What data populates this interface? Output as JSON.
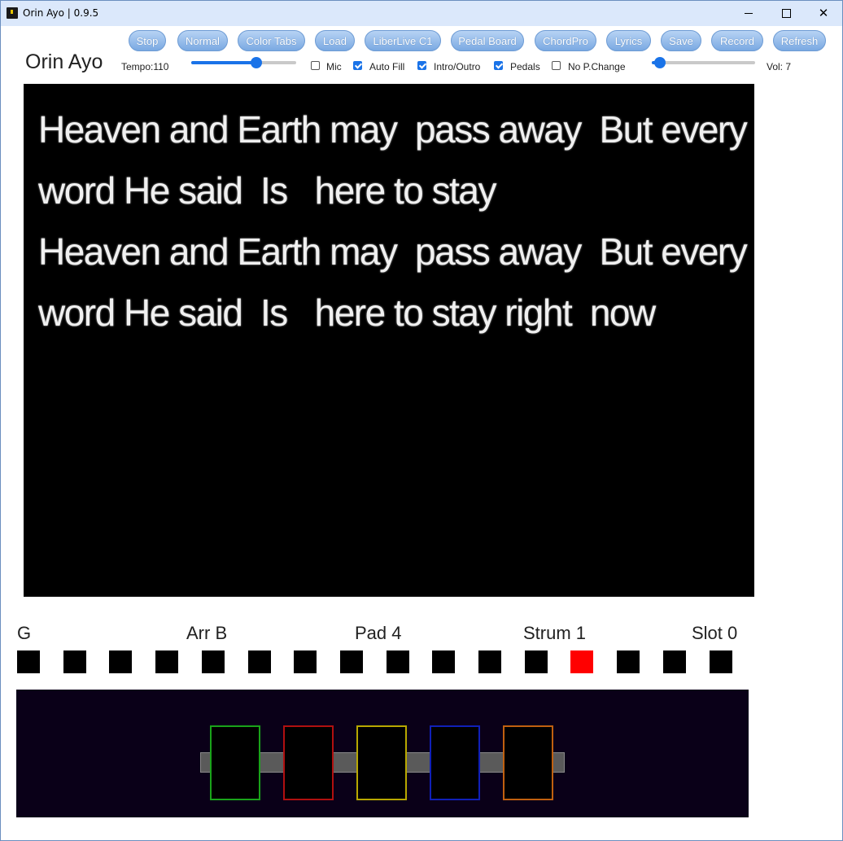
{
  "window": {
    "title": "Orin Ayo | 0.9.5",
    "controls": {
      "minimize": "minimize-icon",
      "maximize": "maximize-icon",
      "close": "close-icon"
    }
  },
  "toolbar": {
    "buttons": [
      "Stop",
      "Normal",
      "Color Tabs",
      "Load",
      "LiberLive C1",
      "Pedal Board",
      "ChordPro",
      "Lyrics",
      "Save",
      "Record",
      "Refresh"
    ]
  },
  "header": {
    "brand": "Orin Ayo",
    "tempo_label": "Tempo:110",
    "tempo_level": 0.62,
    "volume_label": "Vol: 7",
    "volume_level": 0.08,
    "options": [
      {
        "label": "Mic",
        "checked": false
      },
      {
        "label": "Auto Fill",
        "checked": true
      },
      {
        "label": "Intro/Outro",
        "checked": true
      },
      {
        "label": "Pedals",
        "checked": true
      },
      {
        "label": "No P.Change",
        "checked": false
      }
    ]
  },
  "lyrics": {
    "lines": [
      "Heaven and Earth may  pass away  But every",
      "word He said  Is   here to stay",
      "Heaven and Earth may  pass away  But every",
      "word He said  Is   here to stay right  now"
    ]
  },
  "status": {
    "chord": "G",
    "arrangement": "Arr B",
    "pad": "Pad 4",
    "strum": "Strum 1",
    "slot": "Slot 0"
  },
  "beats": {
    "count": 16,
    "active_index": 12,
    "active_color": "#ff0000",
    "inactive_color": "#000000"
  },
  "pedalboard": {
    "pedals": [
      {
        "color": "#1aa31a"
      },
      {
        "color": "#b01010"
      },
      {
        "color": "#b8a800"
      },
      {
        "color": "#1020b8"
      },
      {
        "color": "#c06010"
      }
    ]
  }
}
